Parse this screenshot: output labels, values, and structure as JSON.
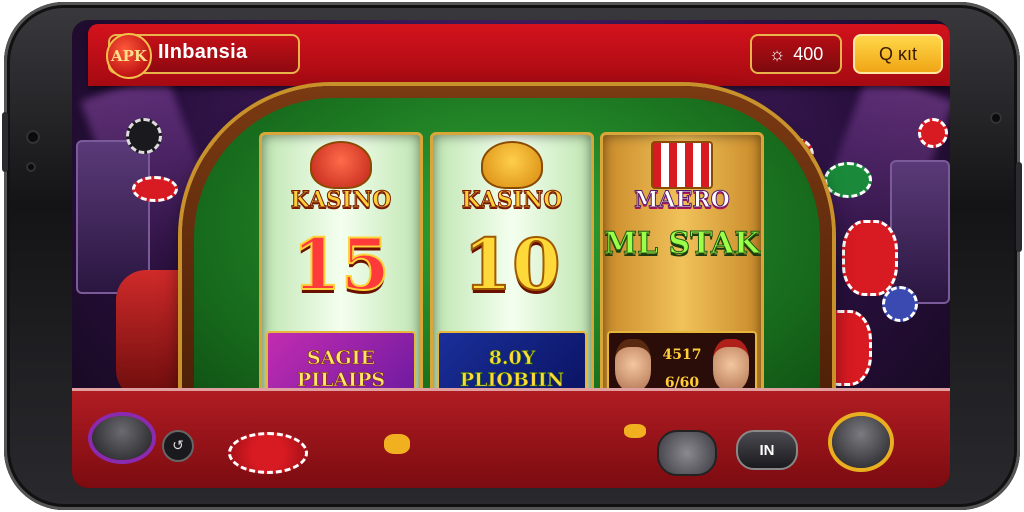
{
  "header": {
    "brand_logo": "APK",
    "brand_name": "IInbansia",
    "coins_value": "400",
    "quit_label": "Q ĸıt"
  },
  "reels": [
    {
      "title": "KASINO",
      "value": "15",
      "panel": "SAGIE PILAIPS"
    },
    {
      "title": "KASINO",
      "value": "10",
      "panel": "8.0Y PLIOBIIN"
    },
    {
      "title": "MAERO",
      "value": "ML STAK",
      "panel_text": "4517",
      "panel_sub": "6/60"
    }
  ],
  "controls": {
    "in_label": "IN"
  },
  "colors": {
    "header_red": "#c8101a",
    "gold": "#e8b34a",
    "felt_green": "#2fa534"
  },
  "icons": [
    "coin-icon",
    "refresh-icon",
    "dpad-icon",
    "joystick-icon"
  ]
}
